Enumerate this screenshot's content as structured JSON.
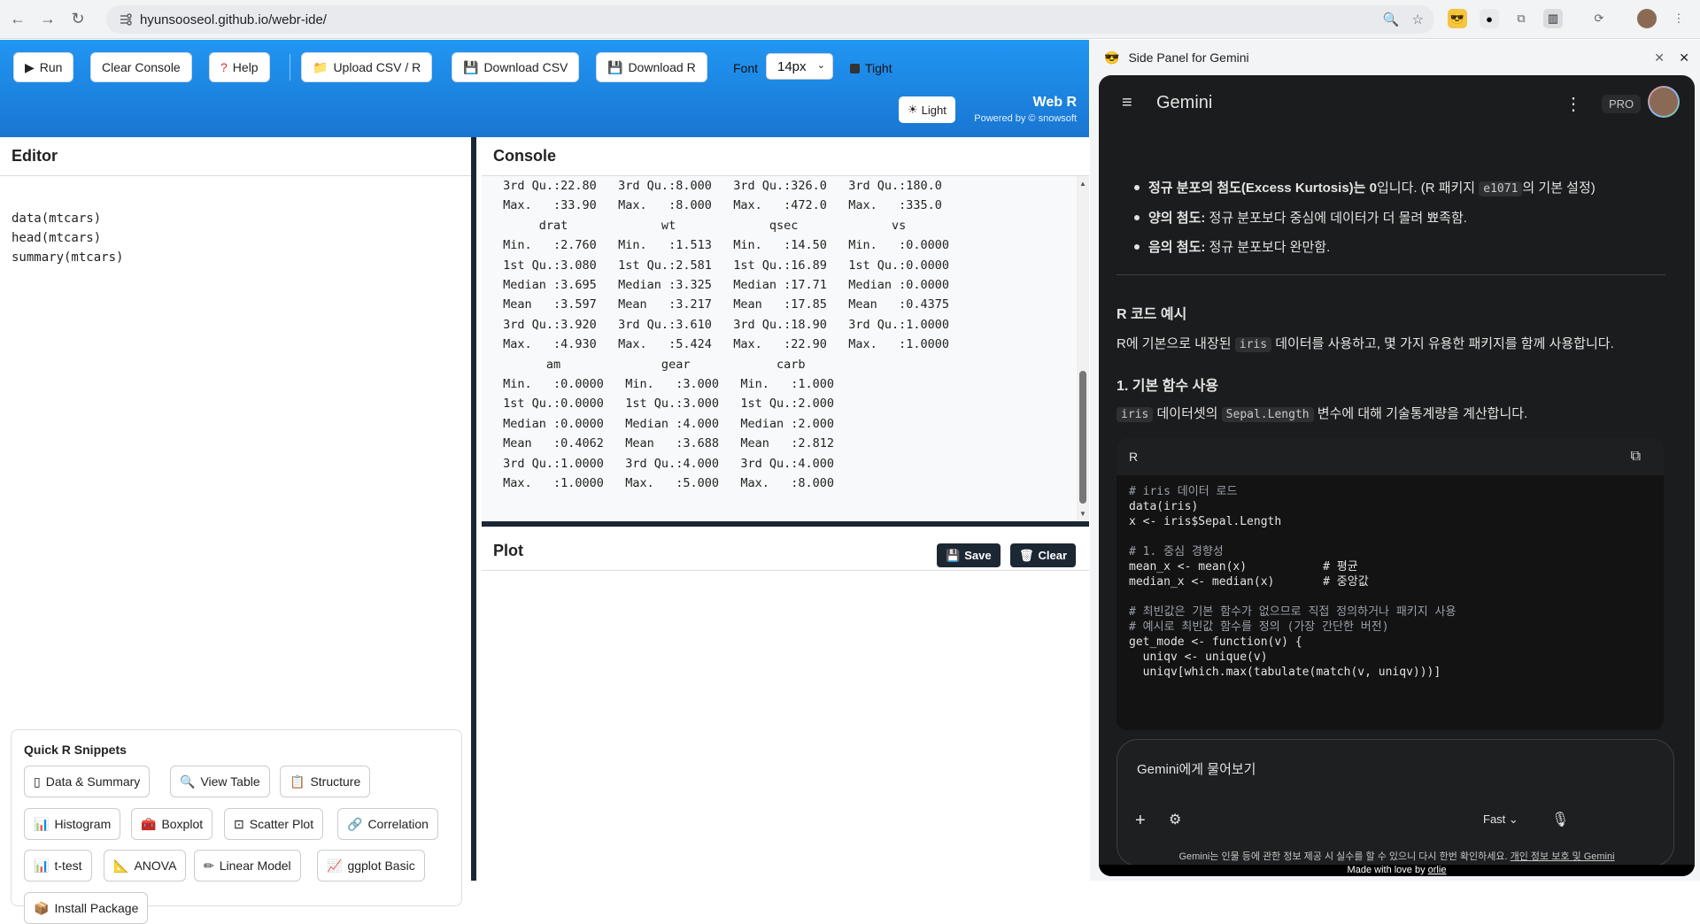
{
  "browser": {
    "url": "hyunsooseol.github.io/webr-ide/"
  },
  "toolbar": {
    "run": "Run",
    "clear_console": "Clear Console",
    "help": "Help",
    "upload": "Upload CSV / R",
    "download_csv": "Download CSV",
    "download_r": "Download R",
    "font_label": "Font",
    "font_value": "14px",
    "tight": "Tight",
    "light": "Light",
    "brand_title": "Web R",
    "brand_sub": "Powered by © snowsoft"
  },
  "editor": {
    "title": "Editor",
    "lines": [
      "data(mtcars)",
      "head(mtcars)",
      "summary(mtcars)"
    ]
  },
  "snippets": {
    "title": "Quick R Snippets",
    "items": [
      "Data & Summary",
      "View Table",
      "Structure",
      "Histogram",
      "Boxplot",
      "Scatter Plot",
      "Correlation",
      "t-test",
      "ANOVA",
      "Linear Model",
      "ggplot Basic",
      "Install Package"
    ]
  },
  "console": {
    "title": "Console",
    "lines": [
      " 3rd Qu.:22.80   3rd Qu.:8.000   3rd Qu.:326.0   3rd Qu.:180.0  ",
      " Max.   :33.90   Max.   :8.000   Max.   :472.0   Max.   :335.0  ",
      "      drat             wt             qsec             vs        ",
      " Min.   :2.760   Min.   :1.513   Min.   :14.50   Min.   :0.0000  ",
      " 1st Qu.:3.080   1st Qu.:2.581   1st Qu.:16.89   1st Qu.:0.0000  ",
      " Median :3.695   Median :3.325   Median :17.71   Median :0.0000  ",
      " Mean   :3.597   Mean   :3.217   Mean   :17.85   Mean   :0.4375  ",
      " 3rd Qu.:3.920   3rd Qu.:3.610   3rd Qu.:18.90   3rd Qu.:1.0000  ",
      " Max.   :4.930   Max.   :5.424   Max.   :22.90   Max.   :1.0000  ",
      "       am              gear            carb      ",
      " Min.   :0.0000   Min.   :3.000   Min.   :1.000  ",
      " 1st Qu.:0.0000   1st Qu.:3.000   1st Qu.:2.000  ",
      " Median :0.0000   Median :4.000   Median :2.000  ",
      " Mean   :0.4062   Mean   :3.688   Mean   :2.812  ",
      " 3rd Qu.:1.0000   3rd Qu.:4.000   3rd Qu.:4.000  ",
      " Max.   :1.0000   Max.   :5.000   Max.   :8.000  "
    ]
  },
  "plot": {
    "title": "Plot",
    "save": "Save",
    "clear": "Clear"
  },
  "side_panel": {
    "title": "Side Panel for Gemini",
    "app_name": "Gemini",
    "pro": "PRO",
    "bullet1_bold": "정규 분포의 첨도(Excess Kurtosis)는 0",
    "bullet1_rest": "입니다. (R 패키지",
    "bullet1_code": "e1071",
    "bullet1_end": "의 기본 설정)",
    "bullet2_bold": "양의 첨도:",
    "bullet2_rest": " 정규 분포보다 중심에 데이터가 더 몰려 뾰족함.",
    "bullet3_bold": "음의 첨도:",
    "bullet3_rest": " 정규 분포보다 완만함.",
    "section_heading": "R 코드 예시",
    "para1_a": "R에 기본으로 내장된",
    "para1_code": "iris",
    "para1_b": "데이터를 사용하고, 몇 가지 유용한 패키지를 함께 사용합니다.",
    "sub_heading": "1. 기본 함수 사용",
    "para2_code1": "iris",
    "para2_a": "데이터셋의",
    "para2_code2": "Sepal.Length",
    "para2_b": "변수에 대해 기술통계량을 계산합니다.",
    "code_lang": "R",
    "code_lines": [
      "# iris 데이터 로드",
      "data(iris)",
      "x <- iris$Sepal.Length",
      "",
      "# 1. 중심 경향성",
      "mean_x <- mean(x)           # 평균",
      "median_x <- median(x)       # 중앙값",
      "",
      "# 최빈값은 기본 함수가 없으므로 직접 정의하거나 패키지 사용",
      "# 예시로 최빈값 함수를 정의 (가장 간단한 버전)",
      "get_mode <- function(v) {",
      "  uniqv <- unique(v)",
      "  uniqv[which.max(tabulate(match(v, uniqv)))]"
    ],
    "input_placeholder": "Gemini에게 물어보기",
    "mode": "Fast",
    "disclaimer": "Gemini는 인물 등에 관한 정보 제공 시 실수를 할 수 있으니 다시 한번 확인하세요.",
    "privacy_link": "개인 정보 보호 및 Gemini",
    "made_with": "Made with love by",
    "author": "orlie"
  }
}
